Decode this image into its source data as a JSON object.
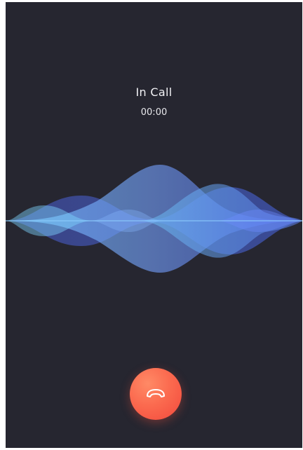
{
  "call": {
    "status": "In Call",
    "timer": "00:00"
  },
  "controls": {
    "end_call_icon": "phone-hangup-icon"
  },
  "colors": {
    "background": "#262630",
    "end_call": "#f75a44",
    "wave_primary": "#5b8bff",
    "wave_secondary": "#4f6fe0",
    "wave_accent": "#79c7ff"
  }
}
